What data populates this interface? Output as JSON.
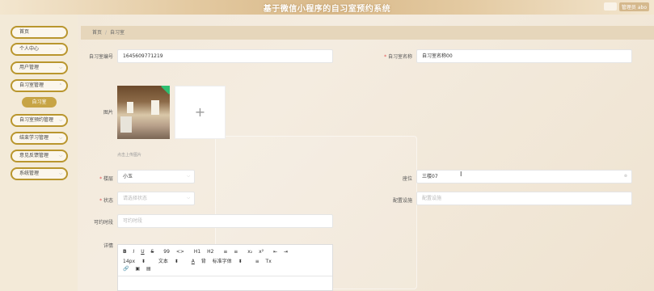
{
  "app": {
    "title": "基于微信小程序的自习室预约系统",
    "user_label": "管理员 abo"
  },
  "sidebar": {
    "items": [
      {
        "label": "首页",
        "has_arrow": false
      },
      {
        "label": "个人中心",
        "has_arrow": true
      },
      {
        "label": "用户管理",
        "has_arrow": true
      },
      {
        "label": "自习室管理",
        "has_arrow": true
      },
      {
        "label": "自习室预约管理",
        "has_arrow": true
      },
      {
        "label": "结束学习管理",
        "has_arrow": true
      },
      {
        "label": "意见反馈管理",
        "has_arrow": true
      },
      {
        "label": "系统管理",
        "has_arrow": true
      }
    ],
    "sub_item": "自习室"
  },
  "breadcrumb": {
    "home": "首页",
    "separator": "/",
    "current": "自习室"
  },
  "form": {
    "room_number_label": "自习室编号",
    "room_number_value": "1645609771219",
    "room_name_label": "自习室名称",
    "room_name_value": "自习室名称00",
    "image_label": "图片",
    "image_hint": "点击上传图片",
    "floor_label": "楼层",
    "floor_value": "小玉",
    "seat_label": "座位",
    "seat_value": "三楼07",
    "status_label": "状态",
    "status_placeholder": "请选择状态",
    "config_label": "配置设施",
    "config_placeholder": "配置设施",
    "open_time_label": "可约时段",
    "open_time_placeholder": "可约时段",
    "detail_label": "详情"
  },
  "editor": {
    "toolbar_row1": [
      "B",
      "I",
      "U",
      "S",
      "99",
      "<>",
      "H1",
      "H2",
      "≡",
      "≡",
      "x₂",
      "x²",
      "⇤",
      "⇥"
    ],
    "toolbar_row2": [
      "14px",
      "文本",
      "A",
      "背",
      "标准字体",
      "≡",
      "Tx"
    ],
    "toolbar_row3": [
      "🔗",
      "▣",
      "▤"
    ]
  }
}
